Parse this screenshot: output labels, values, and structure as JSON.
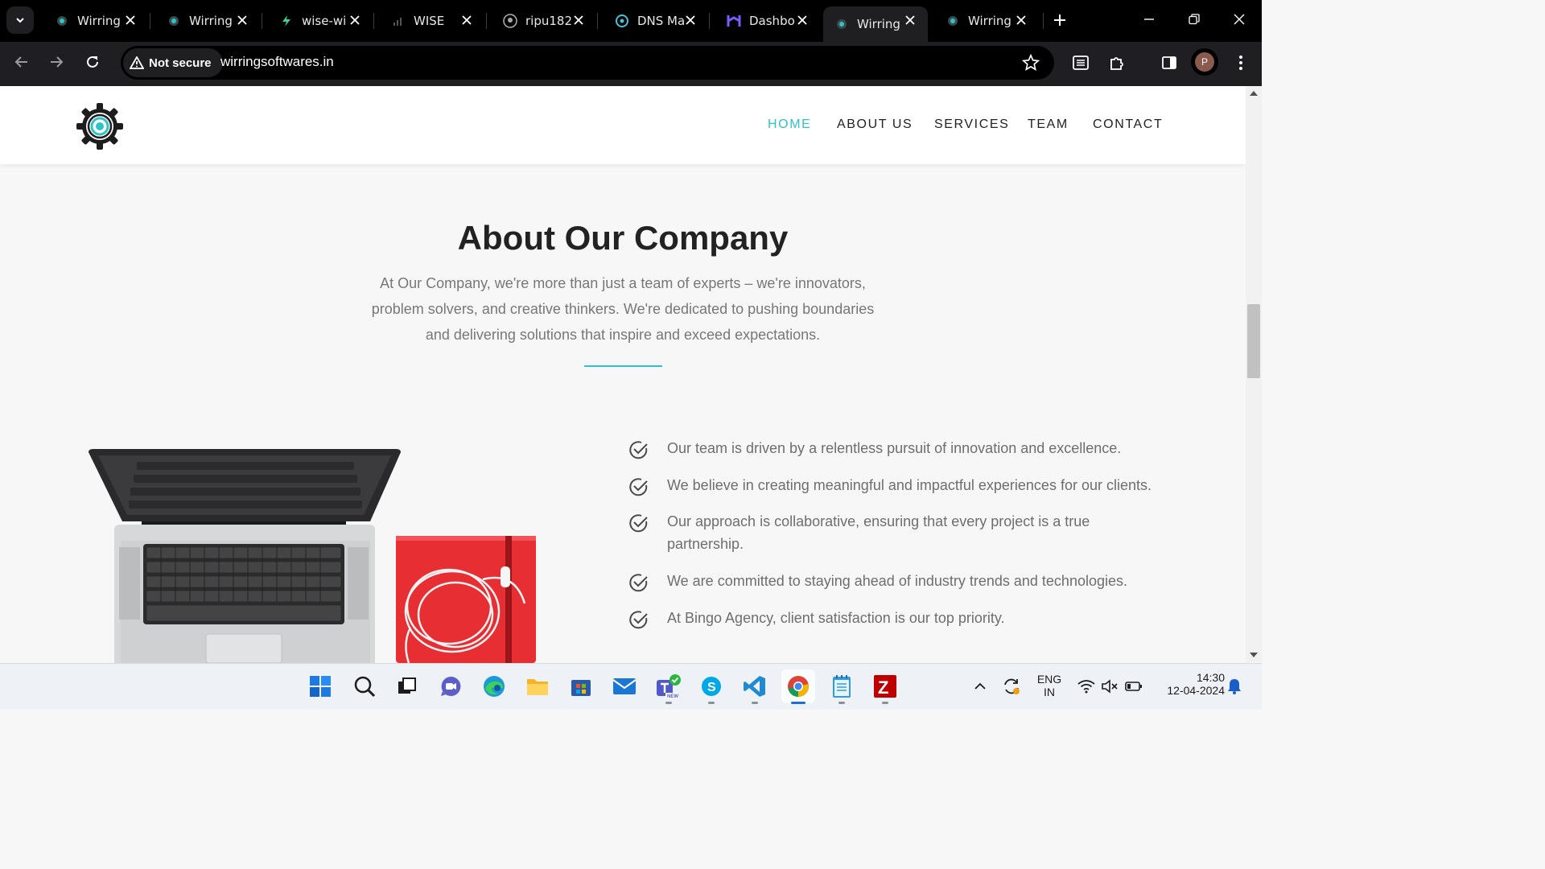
{
  "browser": {
    "tabs": [
      {
        "title": "Wirring",
        "favicon": "gear-favicon",
        "active": false
      },
      {
        "title": "Wirring",
        "favicon": "gear-favicon",
        "active": false
      },
      {
        "title": "wise-wi",
        "favicon": "bolt-favicon",
        "active": false
      },
      {
        "title": "WISE",
        "favicon": "signal-favicon",
        "active": false
      },
      {
        "title": "ripu182",
        "favicon": "github-favicon",
        "active": false
      },
      {
        "title": "DNS Ma",
        "favicon": "dns-favicon",
        "active": false
      },
      {
        "title": "Dashbo",
        "favicon": "dashboard-favicon",
        "active": false
      },
      {
        "title": "Wirring",
        "favicon": "gear-favicon",
        "active": true
      },
      {
        "title": "Wirring",
        "favicon": "gear-favicon",
        "active": false
      }
    ],
    "security_label": "Not secure",
    "url": "wirringsoftwares.in",
    "profile_initial": "P"
  },
  "site": {
    "nav": [
      {
        "label": "HOME",
        "active": true
      },
      {
        "label": "ABOUT US",
        "active": false
      },
      {
        "label": "SERVICES",
        "active": false
      },
      {
        "label": "TEAM",
        "active": false
      },
      {
        "label": "CONTACT",
        "active": false
      }
    ],
    "about": {
      "title": "About Our Company",
      "text": "At Our Company, we're more than just a team of experts – we're innovators, problem solvers, and creative thinkers. We're dedicated to pushing boundaries and delivering solutions that inspire and exceed expectations.",
      "features": [
        "Our team is driven by a relentless pursuit of innovation and excellence.",
        "We believe in creating meaningful and impactful experiences for our clients.",
        "Our approach is collaborative, ensuring that every project is a true partnership.",
        "We are committed to staying ahead of industry trends and technologies.",
        "At Bingo Agency, client satisfaction is our top priority."
      ]
    },
    "accent_color": "#2ec4c7"
  },
  "taskbar": {
    "apps": [
      "windows-start",
      "search",
      "task-view",
      "chat",
      "edge",
      "file-explorer",
      "microsoft-store",
      "mail",
      "teams",
      "skype",
      "vscode",
      "chrome",
      "notepad",
      "filezilla"
    ],
    "language_line1": "ENG",
    "language_line2": "IN",
    "time": "14:30",
    "date": "12-04-2024"
  }
}
